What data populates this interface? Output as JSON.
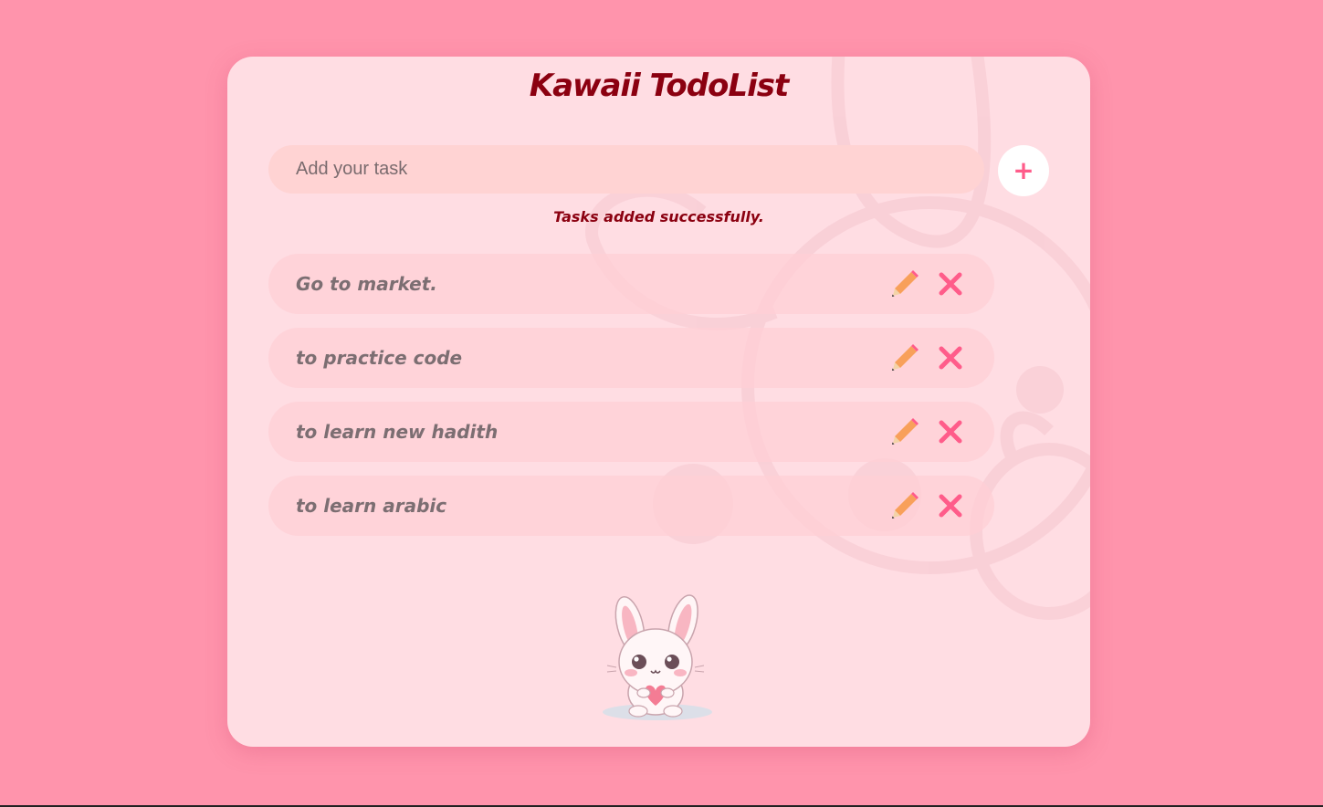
{
  "app": {
    "title": "Kawaii TodoList"
  },
  "input": {
    "placeholder": "Add your task",
    "value": ""
  },
  "add_button": {
    "label": "+"
  },
  "status_message": "Tasks added successfully.",
  "tasks": [
    {
      "text": "Go to market."
    },
    {
      "text": "to practice code"
    },
    {
      "text": "to learn new hadith"
    },
    {
      "text": "to learn arabic"
    }
  ],
  "icons": {
    "edit": "pencil-icon",
    "delete": "close-icon",
    "mascot": "bunny-with-heart"
  },
  "colors": {
    "page_background": "#ff94ac",
    "card_background": "#ffdde3",
    "title": "#8b0010",
    "input_background": "#ffd3d3",
    "accent": "#ff5c8a",
    "pencil": "#f8a05a",
    "task_text": "#7c6e72"
  }
}
